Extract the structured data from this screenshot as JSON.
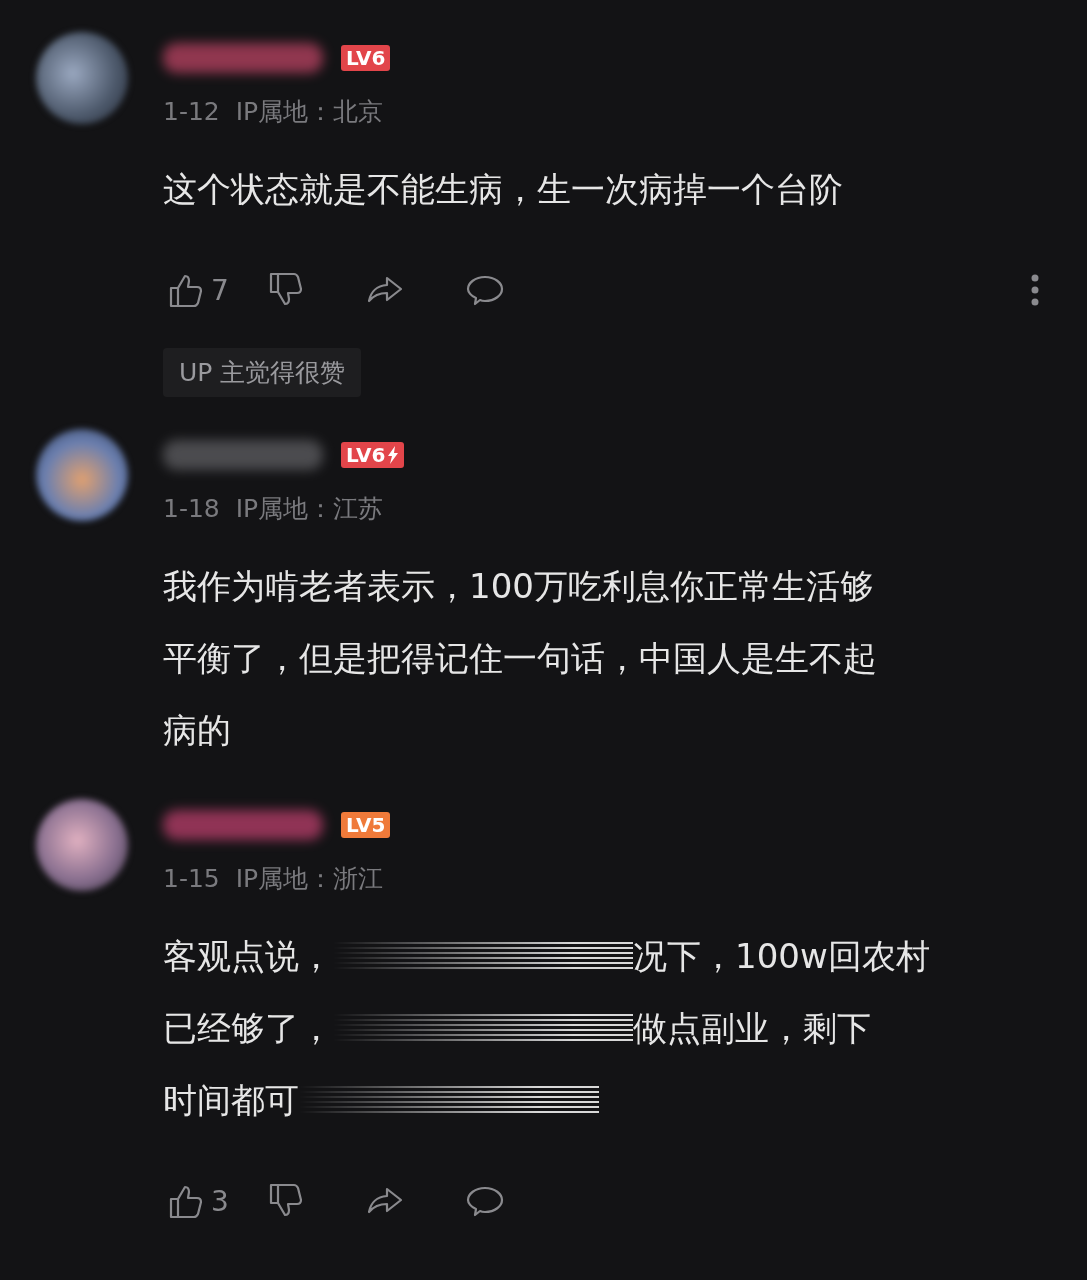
{
  "comments": [
    {
      "level": "LV6",
      "color": "#e2454a",
      "hardcore": false,
      "date": "1-12",
      "ip": "IP属地：北京",
      "lines": [
        {
          "segments": [
            {
              "kind": "text",
              "text": "这个状态就是不能生病，生一次病掉一个台阶"
            }
          ]
        }
      ],
      "actions": {
        "likes": "7",
        "more": true
      },
      "up_tag": "UP 主觉得很赞"
    },
    {
      "level": "LV6",
      "color": "#e2454a",
      "hardcore": true,
      "date": "1-18",
      "ip": "IP属地：江苏",
      "lines": [
        {
          "segments": [
            {
              "kind": "text",
              "text": "我作为啃老者表示，100万吃利息你正常生活够"
            }
          ]
        },
        {
          "segments": [
            {
              "kind": "text",
              "text": "平衡了，但是把得记住一句话，中国人是生不起"
            }
          ]
        },
        {
          "segments": [
            {
              "kind": "text",
              "text": "病的"
            }
          ]
        }
      ]
    },
    {
      "level": "LV5",
      "color": "#ef7a3a",
      "hardcore": false,
      "date": "1-15",
      "ip": "IP属地：浙江",
      "lines": [
        {
          "segments": [
            {
              "kind": "text",
              "text": "客观点说，"
            },
            {
              "kind": "redacted"
            },
            {
              "kind": "text",
              "text": "况下，100w回农村"
            }
          ]
        },
        {
          "segments": [
            {
              "kind": "text",
              "text": "已经够了，"
            },
            {
              "kind": "redacted"
            },
            {
              "kind": "text",
              "text": "做点副业，剩下"
            }
          ]
        },
        {
          "segments": [
            {
              "kind": "text",
              "text": "时间都可"
            },
            {
              "kind": "redacted"
            }
          ]
        }
      ],
      "actions": {
        "likes": "3",
        "more": false
      }
    }
  ]
}
